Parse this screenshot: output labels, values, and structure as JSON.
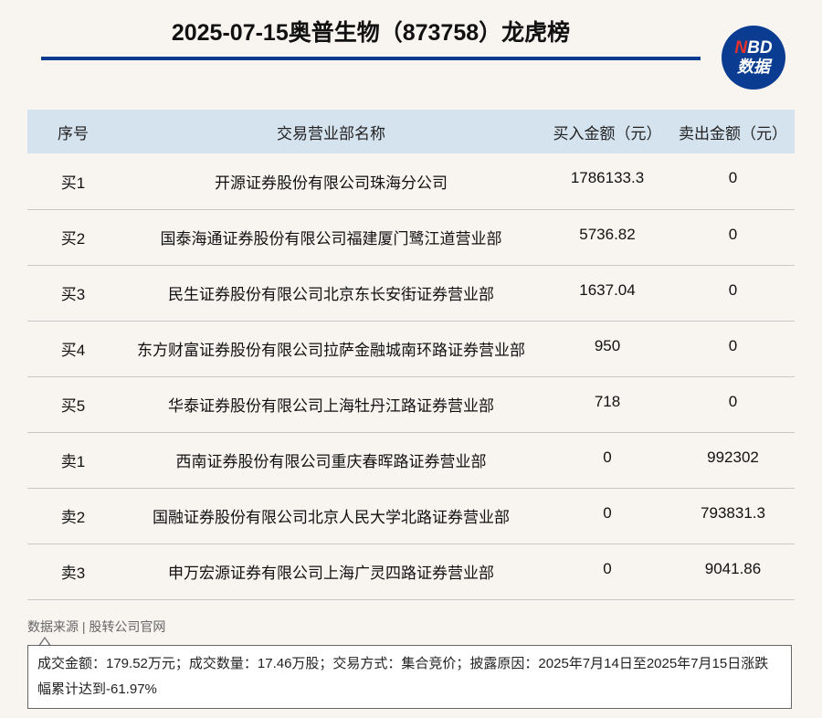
{
  "header": {
    "title": "2025-07-15奥普生物（873758）龙虎榜",
    "logo_top": "NBD",
    "logo_top_accent": "N",
    "logo_top_rest": "BD",
    "logo_bottom": "数据"
  },
  "table": {
    "columns": [
      "序号",
      "交易营业部名称",
      "买入金额（元）",
      "卖出金额（元）"
    ],
    "rows": [
      [
        "买1",
        "开源证券股份有限公司珠海分公司",
        "1786133.3",
        "0"
      ],
      [
        "买2",
        "国泰海通证券股份有限公司福建厦门鹭江道营业部",
        "5736.82",
        "0"
      ],
      [
        "买3",
        "民生证券股份有限公司北京东长安街证券营业部",
        "1637.04",
        "0"
      ],
      [
        "买4",
        "东方财富证券股份有限公司拉萨金融城南环路证券营业部",
        "950",
        "0"
      ],
      [
        "买5",
        "华泰证券股份有限公司上海牡丹江路证券营业部",
        "718",
        "0"
      ],
      [
        "卖1",
        "西南证券股份有限公司重庆春晖路证券营业部",
        "0",
        "992302"
      ],
      [
        "卖2",
        "国融证券股份有限公司北京人民大学北路证券营业部",
        "0",
        "793831.3"
      ],
      [
        "卖3",
        "申万宏源证券有限公司上海广灵四路证券营业部",
        "0",
        "9041.86"
      ]
    ]
  },
  "footer": {
    "source": "数据来源 | 股转公司官网",
    "note": "成交金额：179.52万元；成交数量：17.46万股；交易方式：集合竞价；披露原因：2025年7月14日至2025年7月15日涨跌幅累计达到-61.97%"
  },
  "colors": {
    "accent": "#0a3d91",
    "header_bg": "#d5e3ef",
    "logo_red": "#e8312b",
    "page_bg": "#f8f5f1"
  }
}
